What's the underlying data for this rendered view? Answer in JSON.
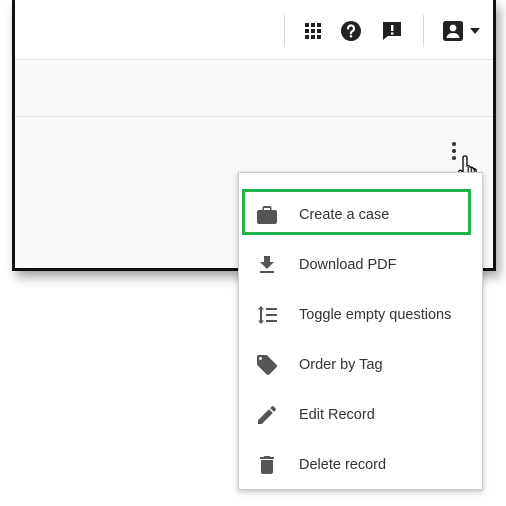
{
  "toolbar": {
    "icons": [
      "apps-icon",
      "help-icon",
      "feedback-icon",
      "account-icon",
      "dropdown-caret-icon"
    ]
  },
  "menu": {
    "items": [
      {
        "label": "Create a case",
        "icon": "briefcase-icon"
      },
      {
        "label": "Download PDF",
        "icon": "download-icon"
      },
      {
        "label": "Toggle empty questions",
        "icon": "toggle-lines-icon"
      },
      {
        "label": "Order by Tag",
        "icon": "tag-icon"
      },
      {
        "label": "Edit Record",
        "icon": "pencil-icon"
      },
      {
        "label": "Delete record",
        "icon": "trash-icon"
      }
    ],
    "highlighted_item": "Create a case",
    "highlight_color": "#1fb34a"
  }
}
